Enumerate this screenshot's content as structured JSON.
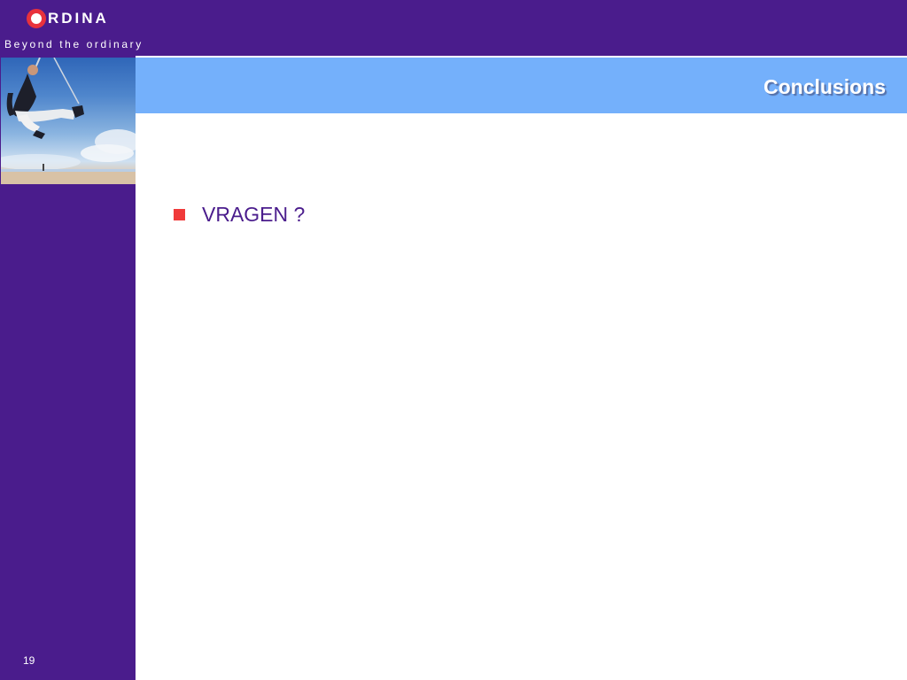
{
  "header": {
    "logo_text": "RDINA",
    "tagline": "Beyond the ordinary"
  },
  "slide": {
    "title": "Conclusions",
    "bullets": [
      "VRAGEN ?"
    ],
    "page_number": "19"
  },
  "colors": {
    "brand_purple": "#4a1c8c",
    "title_bar_blue": "#74b0fb",
    "bullet_red": "#f03a3a",
    "logo_red": "#e8323c"
  }
}
